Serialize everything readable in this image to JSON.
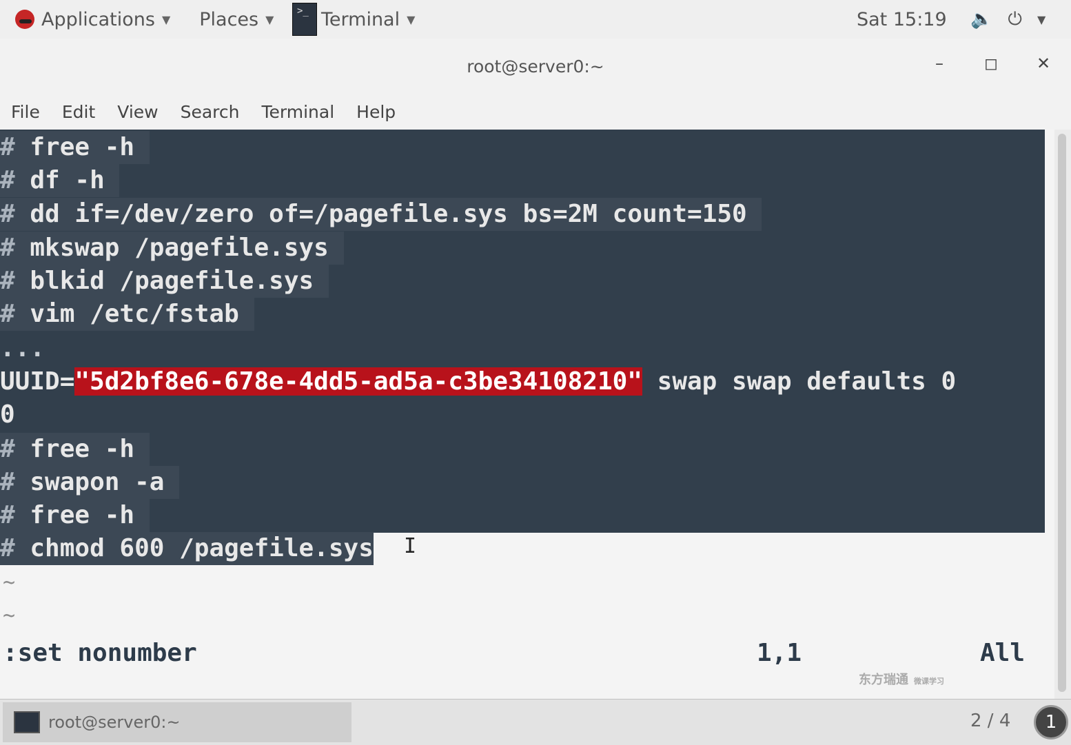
{
  "top_panel": {
    "applications": "Applications",
    "places": "Places",
    "terminal": "Terminal",
    "clock": "Sat 15:19"
  },
  "window": {
    "title": "root@server0:~",
    "minimize": "–",
    "maximize": "◻",
    "close": "✕"
  },
  "menu": [
    "File",
    "Edit",
    "View",
    "Search",
    "Terminal",
    "Help"
  ],
  "editor": {
    "lines": [
      "free -h",
      "df -h",
      "dd if=/dev/zero of=/pagefile.sys bs=2M count=150",
      "mkswap /pagefile.sys",
      "blkid /pagefile.sys",
      "vim /etc/fstab"
    ],
    "ellipsis": "...",
    "uuid_prefix": "UUID=",
    "uuid_value": "\"5d2bf8e6-678e-4dd5-ad5a-c3be34108210\"",
    "uuid_suffix": " swap swap defaults 0",
    "uuid_wrap": "0",
    "lines2": [
      "free -h",
      "swapon -a",
      "free -h",
      "chmod 600 /pagefile.sys"
    ],
    "tilde": "~",
    "command_line": ":set nonumber",
    "position": "1,1",
    "scroll_pos": "All"
  },
  "bottom_panel": {
    "task": "root@server0:~",
    "workspace": "2 / 4",
    "badge": "1"
  },
  "watermark": {
    "main": "东方瑞通",
    "sub": "微课学习"
  }
}
